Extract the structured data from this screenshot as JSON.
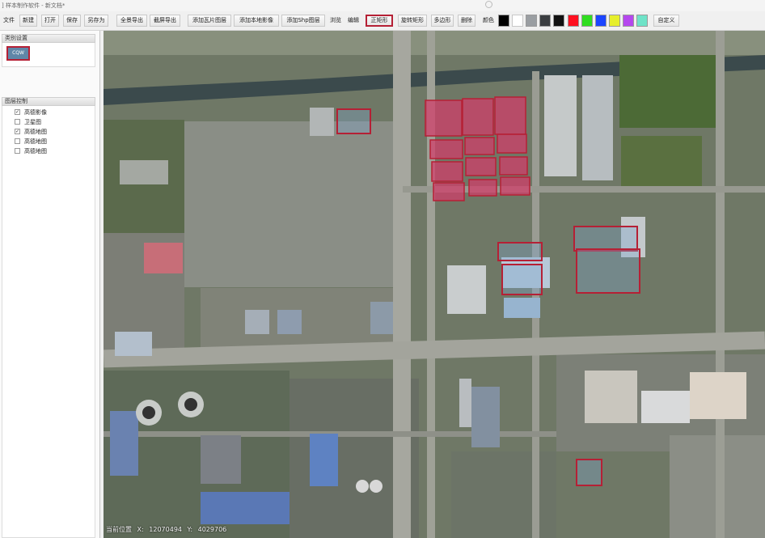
{
  "window": {
    "title": "] 样本制作软件 - 新文档*"
  },
  "toolbar": {
    "buttons": {
      "file": "文件",
      "new": "新建",
      "open": "打开",
      "save": "保存",
      "save_as": "另存为",
      "export_full": "全景导出",
      "export_screen": "截屏导出",
      "add_tile": "添加瓦片图层",
      "add_local_image": "添加本地影像",
      "add_shp": "添加Shp图层",
      "browse": "浏览",
      "edit": "编辑",
      "rect": "正矩形",
      "rotated_rect": "旋转矩形",
      "polygon": "多边形",
      "delete": "删除",
      "custom": "自定义"
    },
    "active_tool": "正矩形",
    "color_label": "颜色",
    "colors": [
      "#000000",
      "#ffffff",
      "#9a9ea2",
      "#3a3d40",
      "#101010",
      "#ff1020",
      "#30dd20",
      "#1b45ff",
      "#e6ef2c",
      "#b547ee",
      "#6fe3c8"
    ]
  },
  "sidebar": {
    "category_panel": {
      "title": "类别设置",
      "category_button": "CQW"
    },
    "layer_panel": {
      "title": "图层控制",
      "layers": [
        {
          "label": "高德影像",
          "checked": true
        },
        {
          "label": "卫星图",
          "checked": false
        },
        {
          "label": "高德地图",
          "checked": true
        },
        {
          "label": "高德地图",
          "checked": false
        },
        {
          "label": "高德地图",
          "checked": false
        }
      ]
    }
  },
  "status": {
    "position_label": "当前位置",
    "x_label": "X:",
    "x_value": "12070494",
    "y_label": "Y:",
    "y_value": "4029706"
  },
  "colors": {
    "annotation": "#b52035",
    "annotation_fill": "#d23c6a"
  }
}
